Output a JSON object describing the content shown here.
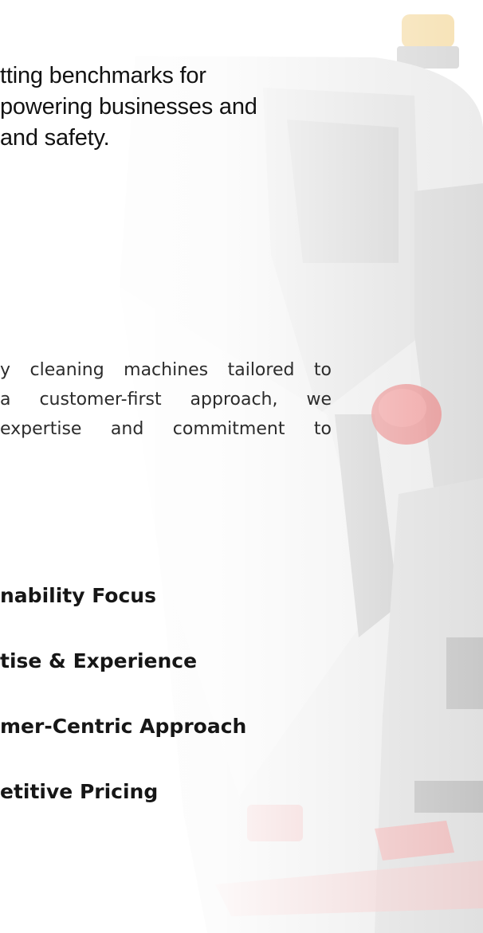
{
  "vision": {
    "lines": [
      "tting benchmarks for",
      "powering businesses and",
      "and safety."
    ]
  },
  "about": {
    "lines": [
      "y cleaning machines tailored to",
      "a customer-first approach, we",
      "expertise and commitment to"
    ]
  },
  "features": [
    "nability Focus",
    "tise & Experience",
    "mer-Centric Approach",
    "etitive Pricing"
  ],
  "colors": {
    "text_primary": "#121212",
    "text_body": "#2c2c2c",
    "machine_gray": "#e6e6e6",
    "accent_red": "#e04848",
    "beacon_amber": "#f2c46a"
  }
}
